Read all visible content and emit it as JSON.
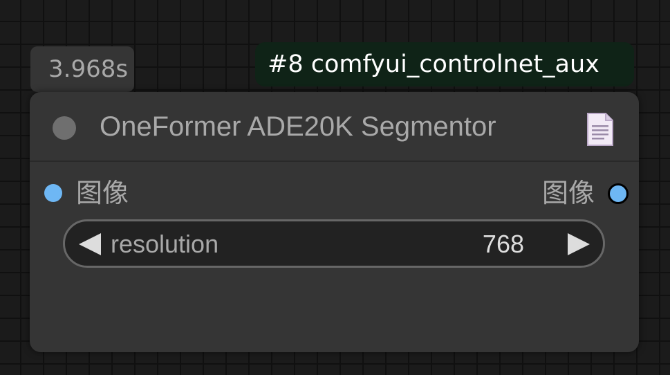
{
  "execution_time": "3.968s",
  "source_badge": "#8 comfyui_controlnet_aux",
  "node": {
    "title": "OneFormer ADE20K Segmentor",
    "input_slot": {
      "label": "图像",
      "color": "#6eb7f4"
    },
    "output_slot": {
      "label": "图像",
      "color": "#6eb7f4"
    },
    "widget": {
      "label": "resolution",
      "value": "768"
    },
    "icons": {
      "collapse": "collapse-dot-icon",
      "docs": "document-icon",
      "decrement": "arrow-left-icon",
      "increment": "arrow-right-icon"
    }
  },
  "colors": {
    "canvas_bg": "#1b1b1b",
    "grid_lines": "#101010",
    "node_bg": "#353535",
    "badge_bg": "#0f2317",
    "widget_bg": "#222222",
    "widget_border": "#676767"
  }
}
